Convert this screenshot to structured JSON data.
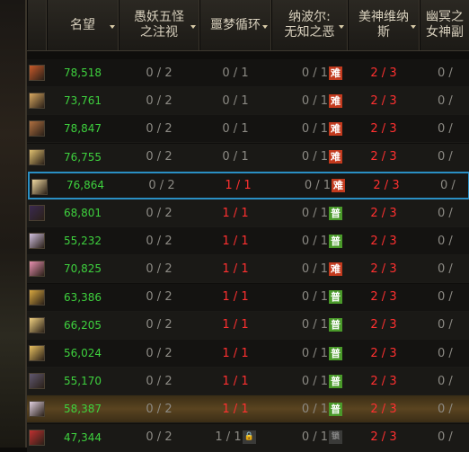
{
  "columns": [
    {
      "label": "名望"
    },
    {
      "label": "愚妖五怪\n之注视"
    },
    {
      "label": "噩梦循环"
    },
    {
      "label": "纳波尔:\n无知之恶"
    },
    {
      "label": "美神维纳\n斯"
    },
    {
      "label": "幽冥之\n女神副"
    }
  ],
  "rows": [
    {
      "fame": "78,518",
      "c1": "0 / 2",
      "c2": "0 / 1",
      "c3": "0 / 1",
      "c3tag": "难",
      "c3type": "hard",
      "c4": "2 / 3",
      "c5": "0 /",
      "avatar": "#c85a2a",
      "state": "normal"
    },
    {
      "fame": "73,761",
      "c1": "0 / 2",
      "c2": "0 / 1",
      "c3": "0 / 1",
      "c3tag": "难",
      "c3type": "hard",
      "c4": "2 / 3",
      "c5": "0 /",
      "avatar": "#d8a860",
      "state": "normal"
    },
    {
      "fame": "78,847",
      "c1": "0 / 2",
      "c2": "0 / 1",
      "c3": "0 / 1",
      "c3tag": "难",
      "c3type": "hard",
      "c4": "2 / 3",
      "c5": "0 /",
      "avatar": "#b07040",
      "state": "normal"
    },
    {
      "fame": "76,755",
      "c1": "0 / 2",
      "c2": "0 / 1",
      "c3": "0 / 1",
      "c3tag": "难",
      "c3type": "hard",
      "c4": "2 / 3",
      "c5": "0 /",
      "avatar": "#e0c070",
      "state": "normal"
    },
    {
      "fame": "76,864",
      "c1": "0 / 2",
      "c2": "1 / 1",
      "c3": "0 / 1",
      "c3tag": "难",
      "c3type": "hard",
      "c4": "2 / 3",
      "c5": "0 /",
      "avatar": "#f0d8a0",
      "state": "selected"
    },
    {
      "fame": "68,801",
      "c1": "0 / 2",
      "c2": "1 / 1",
      "c3": "0 / 1",
      "c3tag": "普",
      "c3type": "normal",
      "c4": "2 / 3",
      "c5": "0 /",
      "avatar": "#3a2a50",
      "state": "normal"
    },
    {
      "fame": "55,232",
      "c1": "0 / 2",
      "c2": "1 / 1",
      "c3": "0 / 1",
      "c3tag": "普",
      "c3type": "normal",
      "c4": "2 / 3",
      "c5": "0 /",
      "avatar": "#d0c0e0",
      "state": "normal"
    },
    {
      "fame": "70,825",
      "c1": "0 / 2",
      "c2": "1 / 1",
      "c3": "0 / 1",
      "c3tag": "难",
      "c3type": "hard",
      "c4": "2 / 3",
      "c5": "0 /",
      "avatar": "#e890b0",
      "state": "normal"
    },
    {
      "fame": "63,386",
      "c1": "0 / 2",
      "c2": "1 / 1",
      "c3": "0 / 1",
      "c3tag": "普",
      "c3type": "normal",
      "c4": "2 / 3",
      "c5": "0 /",
      "avatar": "#d8a840",
      "state": "normal"
    },
    {
      "fame": "66,205",
      "c1": "0 / 2",
      "c2": "1 / 1",
      "c3": "0 / 1",
      "c3tag": "普",
      "c3type": "normal",
      "c4": "2 / 3",
      "c5": "0 /",
      "avatar": "#f0d080",
      "state": "normal"
    },
    {
      "fame": "56,024",
      "c1": "0 / 2",
      "c2": "1 / 1",
      "c3": "0 / 1",
      "c3tag": "普",
      "c3type": "normal",
      "c4": "2 / 3",
      "c5": "0 /",
      "avatar": "#e8c060",
      "state": "normal"
    },
    {
      "fame": "55,170",
      "c1": "0 / 2",
      "c2": "1 / 1",
      "c3": "0 / 1",
      "c3tag": "普",
      "c3type": "normal",
      "c4": "2 / 3",
      "c5": "0 /",
      "avatar": "#605870",
      "state": "normal"
    },
    {
      "fame": "58,387",
      "c1": "0 / 2",
      "c2": "1 / 1",
      "c3": "0 / 1",
      "c3tag": "普",
      "c3type": "normal",
      "c4": "2 / 3",
      "c5": "0 /",
      "avatar": "#e0d0e0",
      "state": "highlight"
    },
    {
      "fame": "47,344",
      "c1": "0 / 2",
      "c2": "1 / 1",
      "c3": "0 / 1",
      "c3tag": "锁",
      "c3type": "locked",
      "c2lock": true,
      "c4": "2 / 3",
      "c5": "0 /",
      "avatar": "#c03030",
      "state": "normal"
    }
  ],
  "colors": {
    "fame": "#3ed13e",
    "cleared": "#ff3030",
    "muted": "#8c8a84",
    "selection": "#2a8fc4",
    "hard": "#c33a1e",
    "normal": "#4a9a2a"
  }
}
